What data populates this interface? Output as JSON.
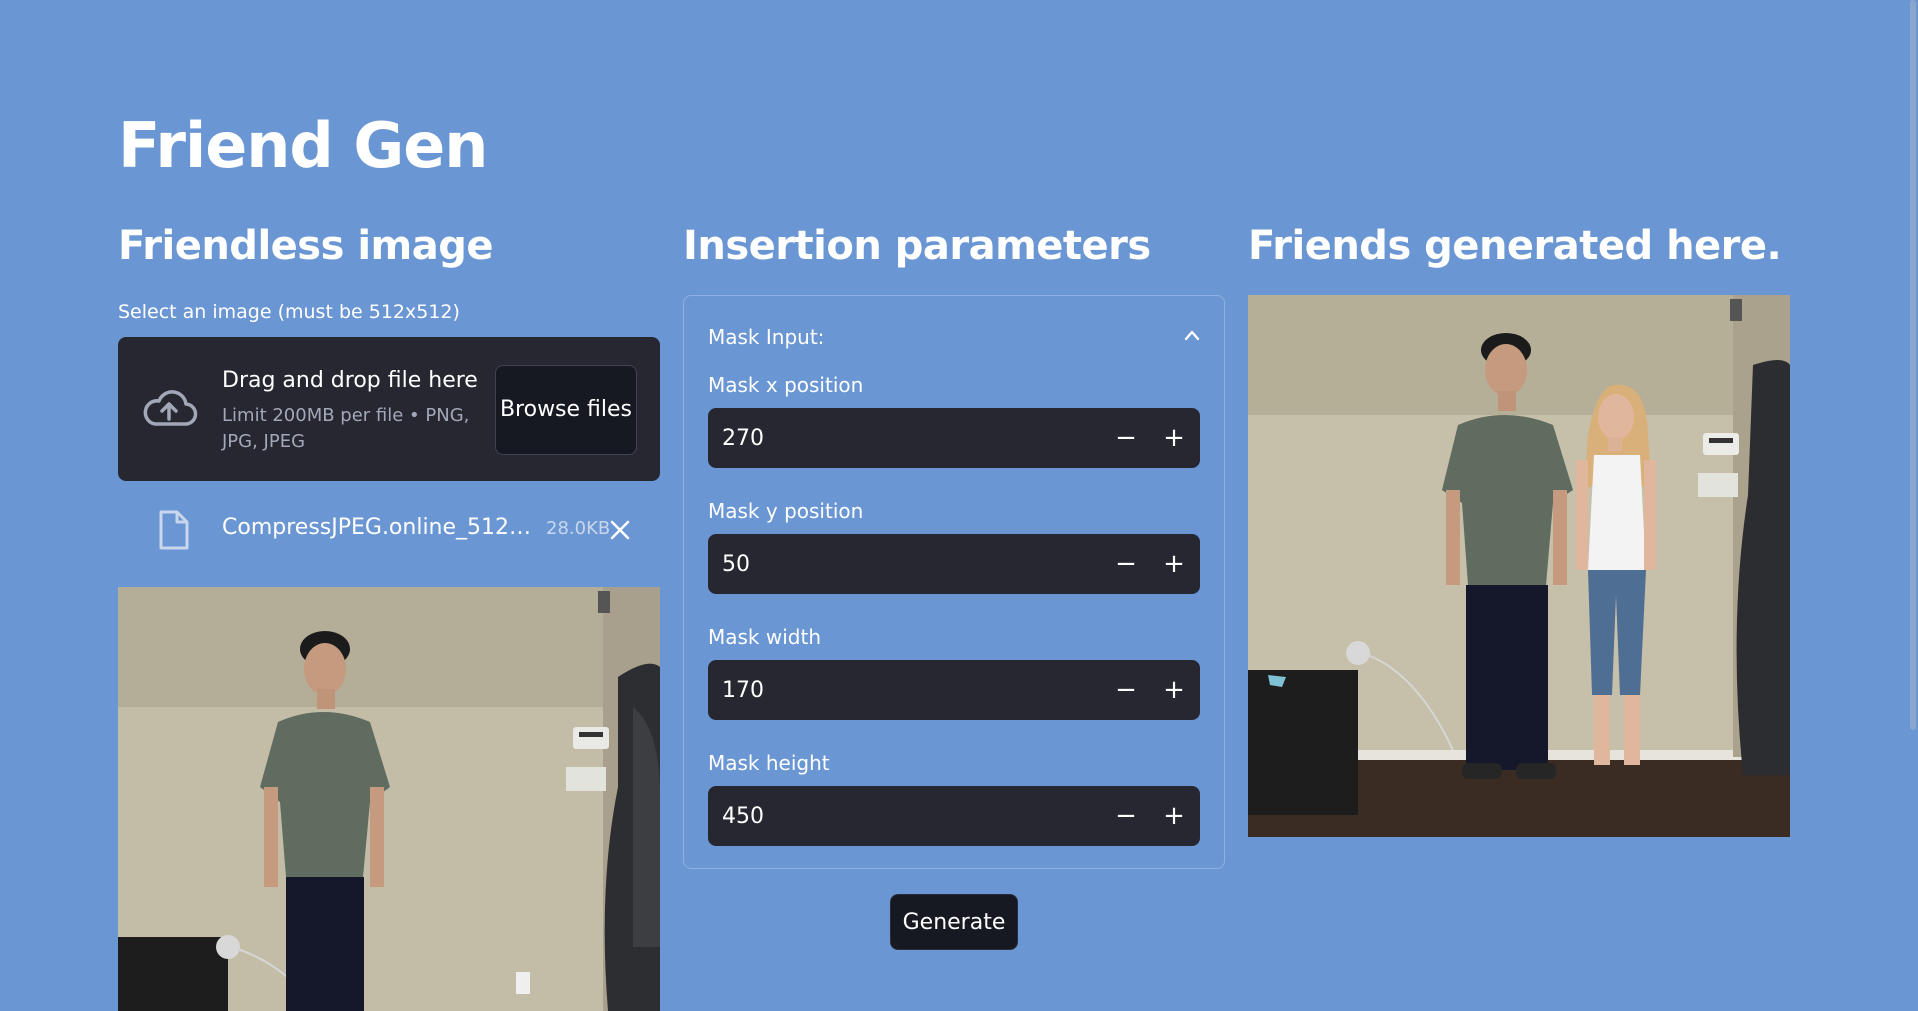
{
  "app": {
    "title": "Friend Gen"
  },
  "left": {
    "heading": "Friendless image",
    "uploader": {
      "label": "Select an image (must be 512x512)",
      "drop_title": "Drag and drop file here",
      "drop_limit": "Limit 200MB per file • PNG, JPG, JPEG",
      "browse_label": "Browse files"
    },
    "file": {
      "name": "CompressJPEG.online_512x512_image.jpg",
      "size": "28.0KB"
    }
  },
  "middle": {
    "heading": "Insertion parameters",
    "expander_title": "Mask Input:",
    "fields": [
      {
        "label": "Mask x position",
        "value": "270"
      },
      {
        "label": "Mask y position",
        "value": "50"
      },
      {
        "label": "Mask width",
        "value": "170"
      },
      {
        "label": "Mask height",
        "value": "450"
      }
    ],
    "minus_label": "−",
    "plus_label": "+",
    "generate_label": "Generate"
  },
  "right": {
    "heading": "Friends generated here."
  },
  "icons": {
    "upload": "cloud-upload-icon",
    "file": "file-icon",
    "remove": "close-icon",
    "collapse": "chevron-up-icon"
  },
  "colors": {
    "background": "#6a96d3",
    "panel": "#262730",
    "button": "#171922",
    "text": "#ffffff"
  }
}
